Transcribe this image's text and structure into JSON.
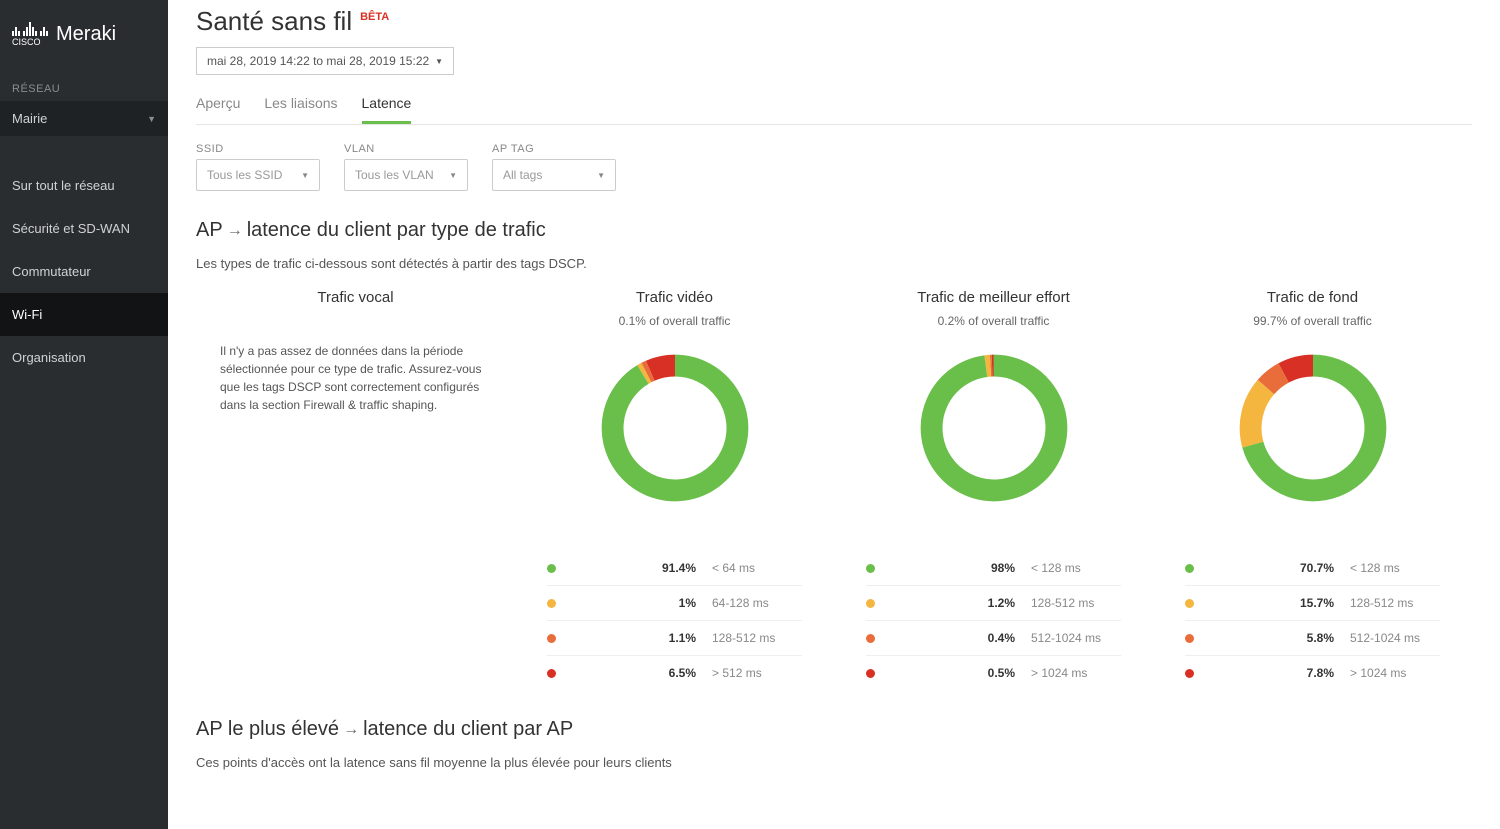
{
  "brand": {
    "cisco": "CISCO",
    "name": "Meraki"
  },
  "sidebar": {
    "section_label": "RÉSEAU",
    "network": "Mairie",
    "items": [
      {
        "label": "Sur tout le réseau"
      },
      {
        "label": "Sécurité et SD-WAN"
      },
      {
        "label": "Commutateur"
      },
      {
        "label": "Wi-Fi"
      },
      {
        "label": "Organisation"
      }
    ],
    "active_index": 3
  },
  "header": {
    "title": "Santé sans fil",
    "badge": "BÊTA",
    "date_range": "mai 28, 2019 14:22 to mai 28, 2019 15:22"
  },
  "tabs": {
    "items": [
      "Aperçu",
      "Les liaisons",
      "Latence"
    ],
    "active_index": 2
  },
  "filters": {
    "ssid": {
      "label": "SSID",
      "value": "Tous les SSID"
    },
    "vlan": {
      "label": "VLAN",
      "value": "Tous les VLAN"
    },
    "aptag": {
      "label": "AP TAG",
      "value": "All tags"
    }
  },
  "section1": {
    "title_pre": "AP",
    "title_post": "latence du client par type de trafic",
    "subtitle": "Les types de trafic ci-dessous sont détectés à partir des tags DSCP."
  },
  "colors": {
    "green": "#6abf4b",
    "yellow": "#f4b63f",
    "orange": "#e86d3a",
    "red": "#d93025"
  },
  "cards": [
    {
      "title": "Trafic vocal",
      "subtitle": "",
      "note": "Il n'y a pas assez de données dans la période sélectionnée pour ce type de trafic. Assurez-vous que les tags DSCP sont correctement configurés dans la section Firewall & traffic shaping.",
      "segments": null
    },
    {
      "title": "Trafic vidéo",
      "subtitle": "0.1% of overall traffic",
      "note": null,
      "segments": [
        {
          "color": "green",
          "pct": 91.4,
          "pct_label": "91.4%",
          "range": "< 64 ms"
        },
        {
          "color": "yellow",
          "pct": 1.0,
          "pct_label": "1%",
          "range": "64-128 ms"
        },
        {
          "color": "orange",
          "pct": 1.1,
          "pct_label": "1.1%",
          "range": "128-512 ms"
        },
        {
          "color": "red",
          "pct": 6.5,
          "pct_label": "6.5%",
          "range": "> 512 ms"
        }
      ]
    },
    {
      "title": "Trafic de meilleur effort",
      "subtitle": "0.2% of overall traffic",
      "note": null,
      "segments": [
        {
          "color": "green",
          "pct": 98.0,
          "pct_label": "98%",
          "range": "< 128 ms"
        },
        {
          "color": "yellow",
          "pct": 1.2,
          "pct_label": "1.2%",
          "range": "128-512 ms"
        },
        {
          "color": "orange",
          "pct": 0.4,
          "pct_label": "0.4%",
          "range": "512-1024 ms"
        },
        {
          "color": "red",
          "pct": 0.5,
          "pct_label": "0.5%",
          "range": "> 1024 ms"
        }
      ]
    },
    {
      "title": "Trafic de fond",
      "subtitle": "99.7% of overall traffic",
      "note": null,
      "segments": [
        {
          "color": "green",
          "pct": 70.7,
          "pct_label": "70.7%",
          "range": "< 128 ms"
        },
        {
          "color": "yellow",
          "pct": 15.7,
          "pct_label": "15.7%",
          "range": "128-512 ms"
        },
        {
          "color": "orange",
          "pct": 5.8,
          "pct_label": "5.8%",
          "range": "512-1024 ms"
        },
        {
          "color": "red",
          "pct": 7.8,
          "pct_label": "7.8%",
          "range": "> 1024 ms"
        }
      ]
    }
  ],
  "section2": {
    "title_pre": "AP le plus élevé",
    "title_post": "latence du client par AP",
    "subtitle": "Ces points d'accès ont la latence sans fil moyenne la plus élevée pour leurs clients"
  },
  "chart_data": {
    "type": "pie",
    "title": "AP → latence du client par type de trafic",
    "series": [
      {
        "name": "Trafic vidéo",
        "overall_traffic_pct": 0.1,
        "categories": [
          "< 64 ms",
          "64-128 ms",
          "128-512 ms",
          "> 512 ms"
        ],
        "values": [
          91.4,
          1.0,
          1.1,
          6.5
        ]
      },
      {
        "name": "Trafic de meilleur effort",
        "overall_traffic_pct": 0.2,
        "categories": [
          "< 128 ms",
          "128-512 ms",
          "512-1024 ms",
          "> 1024 ms"
        ],
        "values": [
          98.0,
          1.2,
          0.4,
          0.5
        ]
      },
      {
        "name": "Trafic de fond",
        "overall_traffic_pct": 99.7,
        "categories": [
          "< 128 ms",
          "128-512 ms",
          "512-1024 ms",
          "> 1024 ms"
        ],
        "values": [
          70.7,
          15.7,
          5.8,
          7.8
        ]
      }
    ]
  }
}
